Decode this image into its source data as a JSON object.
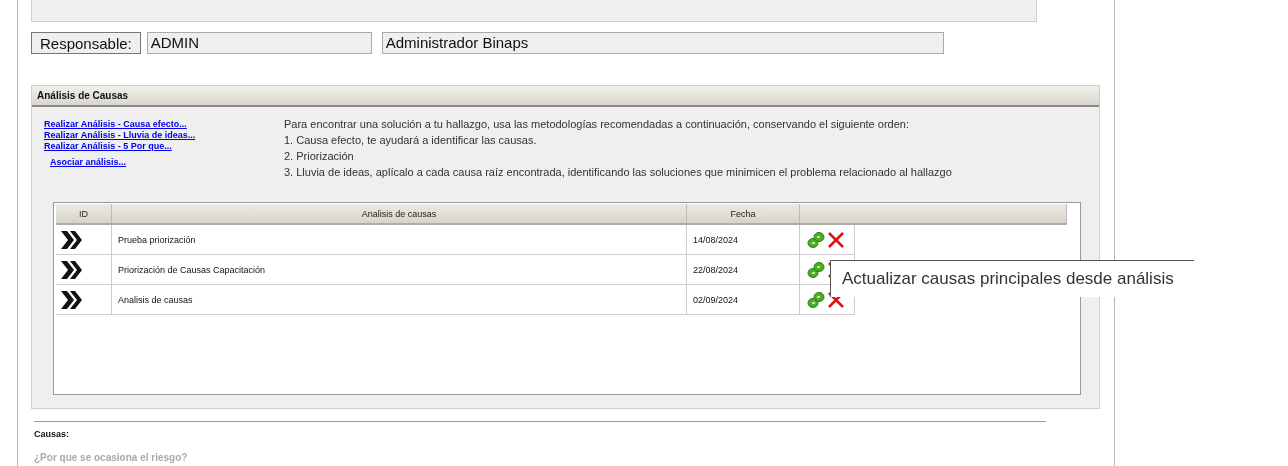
{
  "responsable": {
    "label": "Responsable:",
    "code": "ADMIN",
    "name": "Administrador Binaps"
  },
  "analysis_section": {
    "title": "Análisis de Causas",
    "links": [
      "Realizar Análisis - Causa efecto...",
      "Realizar Análisis - Lluvia de ideas...",
      "Realizar Análisis - 5 Por que..."
    ],
    "associate_link": "Asociar análisis...",
    "instructions": [
      "Para encontrar una solución a tu hallazgo, usa las metodologías recomendadas a continuación, conservando el siguiente orden:",
      "1. Causa efecto, te ayudará a identificar las causas.",
      "2. Priorización",
      "3. Lluvia de ideas, aplícalo a cada causa raíz encontrada, identificando las soluciones que minimicen el problema relacionado al hallazgo"
    ],
    "table": {
      "columns": [
        "ID",
        "Analisis de causas",
        "Fecha"
      ],
      "rows": [
        {
          "name": "Prueba priorización",
          "date": "14/08/2024"
        },
        {
          "name": "Priorización de Causas Capacitación",
          "date": "22/08/2024"
        },
        {
          "name": "Analisis de causas",
          "date": "02/09/2024"
        }
      ]
    },
    "tooltip": "Actualizar causas principales desde análisis"
  },
  "causas": {
    "label": "Causas:",
    "placeholder": "¿Por que se ocasiona el riesgo?"
  }
}
